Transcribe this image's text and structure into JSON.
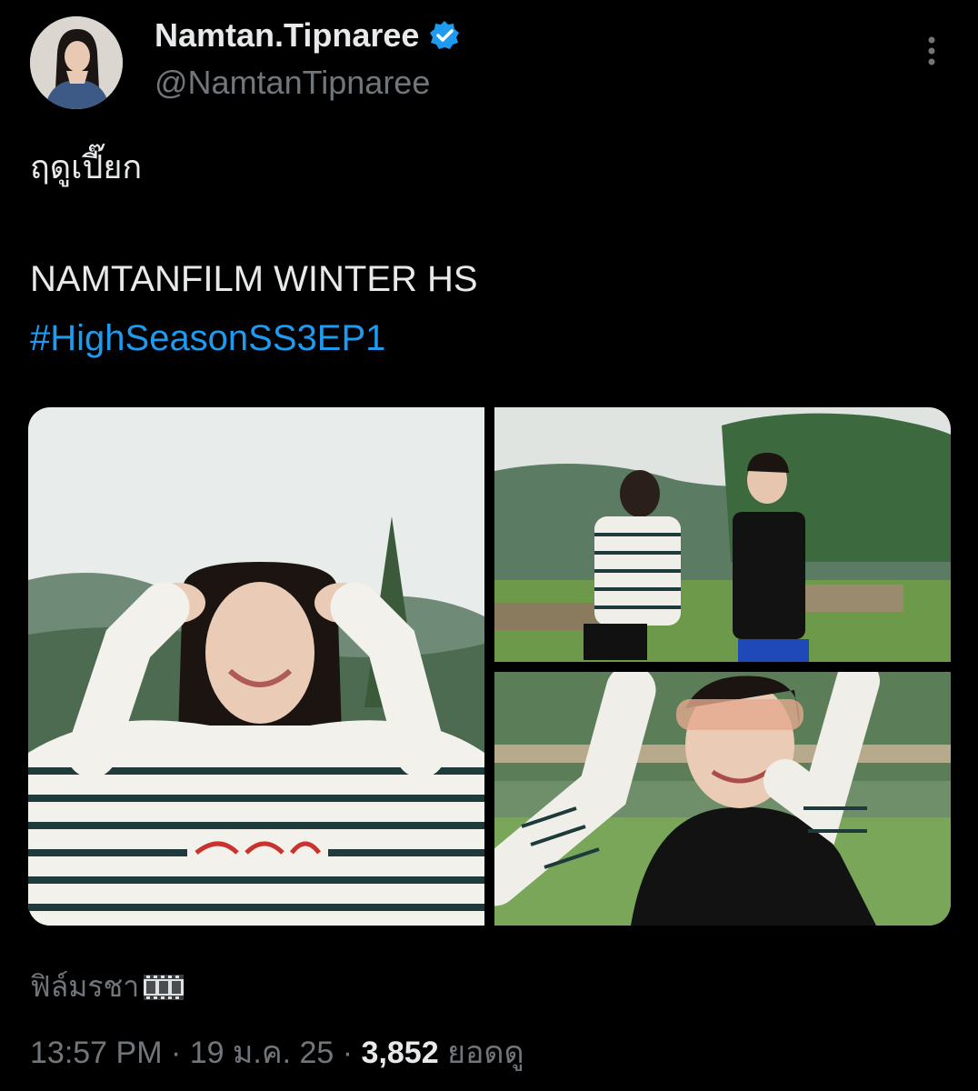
{
  "author": {
    "display_name": "Namtan.Tipnaree",
    "handle": "@NamtanTipnaree",
    "verified": true
  },
  "tweet": {
    "line1": "ฤดูเปี๊ยก",
    "line2": "NAMTANFILM WINTER HS",
    "hashtag": "#HighSeasonSS3EP1",
    "alt_line": "ฟิล์มรชา"
  },
  "meta": {
    "time": "13:57 PM",
    "sep1": " · ",
    "date": "19 ม.ค. 25",
    "sep2": " · ",
    "views": "3,852",
    "views_label": " ยอดดู"
  },
  "icons": {
    "verified": "verified-badge-icon",
    "more": "more-vertical-icon",
    "film": "film-strip-icon"
  },
  "colors": {
    "background": "#000000",
    "text": "#e7e9ea",
    "muted": "#71767b",
    "link": "#1d9bf0"
  }
}
